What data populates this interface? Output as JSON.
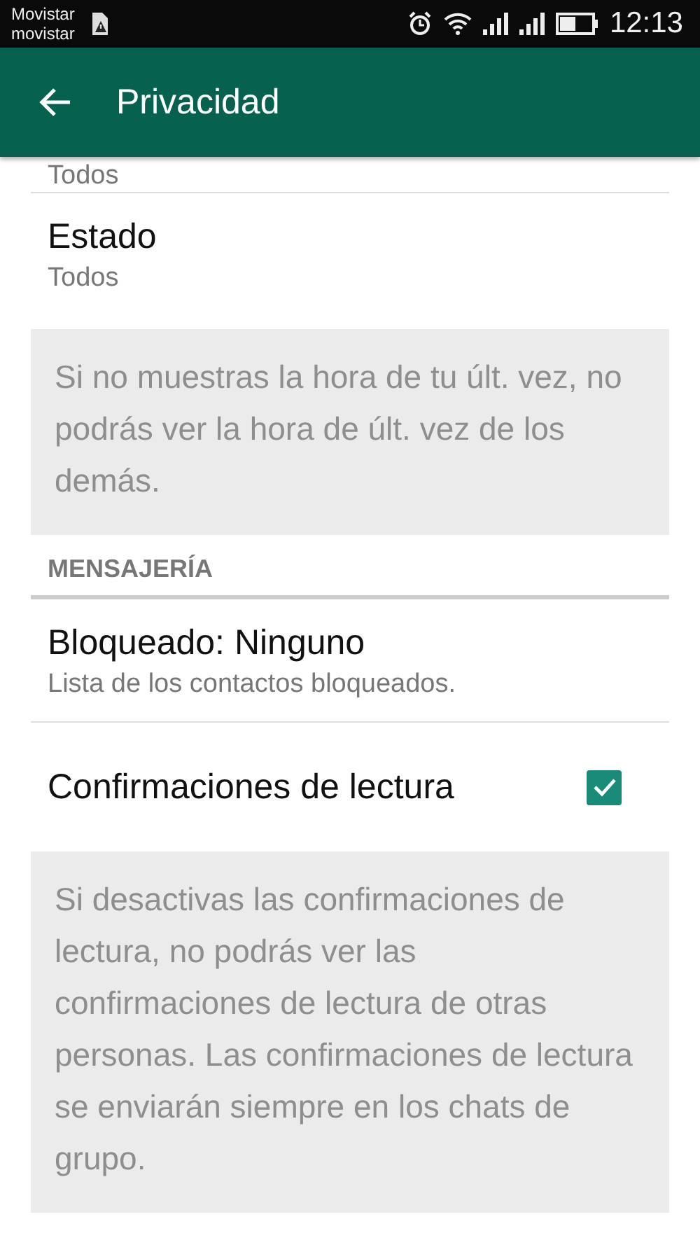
{
  "status_bar": {
    "carriers": [
      "Movistar",
      "movistar"
    ],
    "time": "12:13"
  },
  "app_bar": {
    "title": "Privacidad"
  },
  "rows": [
    {
      "kind": "subtitle_only",
      "subtitle": "Todos"
    },
    {
      "kind": "value",
      "title": "Estado",
      "subtitle": "Todos"
    },
    {
      "kind": "note",
      "text": "Si no muestras la hora de tu últ. vez, no podrás ver la hora de últ. vez de los demás."
    },
    {
      "kind": "header",
      "text": "MENSAJERÍA"
    },
    {
      "kind": "value",
      "title": "Bloqueado: Ninguno",
      "subtitle": "Lista de los contactos bloqueados."
    },
    {
      "kind": "checkbox",
      "title": "Confirmaciones de lectura",
      "checked": true
    },
    {
      "kind": "note",
      "text": "Si desactivas las confirmaciones de lectura, no podrás ver las confirmaciones de lectura de otras personas. Las confirmaciones de lectura se enviarán siempre en los chats de grupo."
    }
  ]
}
